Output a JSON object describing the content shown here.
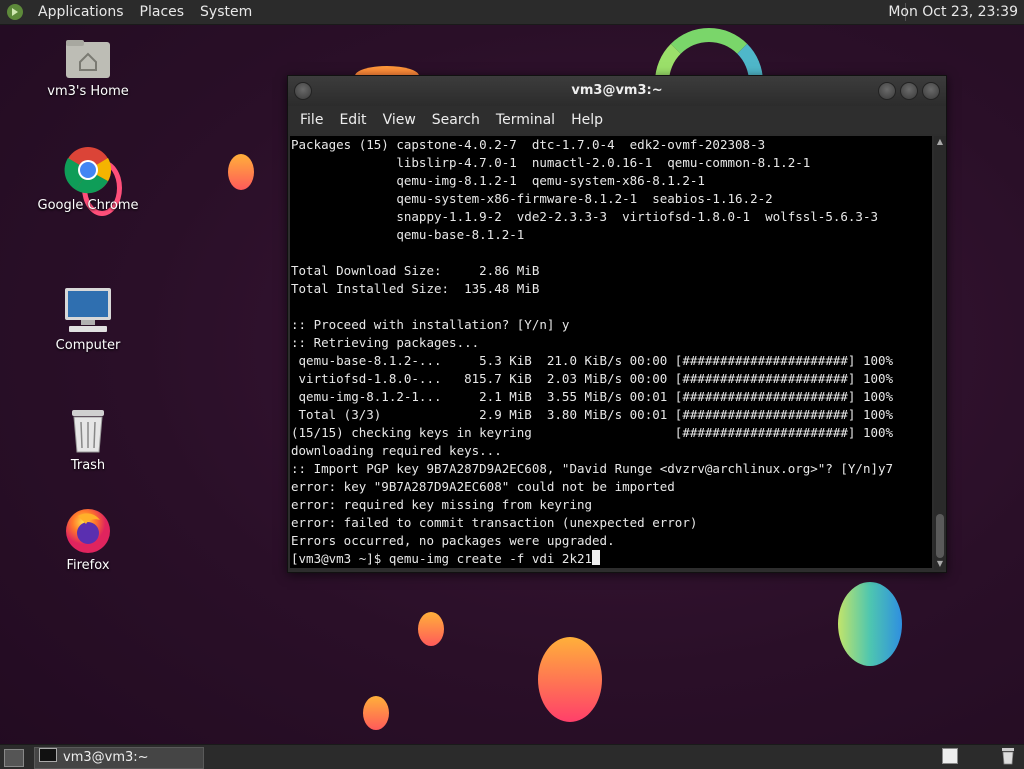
{
  "top_panel": {
    "menus": [
      "Applications",
      "Places",
      "System"
    ],
    "clock": "Mon Oct 23, 23:39"
  },
  "desktop_icons": [
    {
      "label": "vm3's Home",
      "icon": "home-folder-icon"
    },
    {
      "label": "Google Chrome",
      "icon": "chrome-icon"
    },
    {
      "label": "Computer",
      "icon": "computer-icon"
    },
    {
      "label": "Trash",
      "icon": "trash-icon"
    },
    {
      "label": "Firefox",
      "icon": "firefox-icon"
    }
  ],
  "terminal": {
    "title": "vm3@vm3:~",
    "menu": [
      "File",
      "Edit",
      "View",
      "Search",
      "Terminal",
      "Help"
    ],
    "lines": [
      "Packages (15) capstone-4.0.2-7  dtc-1.7.0-4  edk2-ovmf-202308-3",
      "              libslirp-4.7.0-1  numactl-2.0.16-1  qemu-common-8.1.2-1",
      "              qemu-img-8.1.2-1  qemu-system-x86-8.1.2-1",
      "              qemu-system-x86-firmware-8.1.2-1  seabios-1.16.2-2",
      "              snappy-1.1.9-2  vde2-2.3.3-3  virtiofsd-1.8.0-1  wolfssl-5.6.3-3",
      "              qemu-base-8.1.2-1",
      "",
      "Total Download Size:     2.86 MiB",
      "Total Installed Size:  135.48 MiB",
      "",
      ":: Proceed with installation? [Y/n] y",
      ":: Retrieving packages...",
      " qemu-base-8.1.2-...     5.3 KiB  21.0 KiB/s 00:00 [######################] 100%",
      " virtiofsd-1.8.0-...   815.7 KiB  2.03 MiB/s 00:00 [######################] 100%",
      " qemu-img-8.1.2-1...     2.1 MiB  3.55 MiB/s 00:01 [######################] 100%",
      " Total (3/3)             2.9 MiB  3.80 MiB/s 00:01 [######################] 100%",
      "(15/15) checking keys in keyring                   [######################] 100%",
      "downloading required keys...",
      ":: Import PGP key 9B7A287D9A2EC608, \"David Runge <dvzrv@archlinux.org>\"? [Y/n]y7",
      "error: key \"9B7A287D9A2EC608\" could not be imported",
      "error: required key missing from keyring",
      "error: failed to commit transaction (unexpected error)",
      "Errors occurred, no packages were upgraded."
    ],
    "prompt": "[vm3@vm3 ~]$ ",
    "command": "qemu-img create -f vdi 2k21"
  },
  "bottom_panel": {
    "task_label": "vm3@vm3:~"
  }
}
